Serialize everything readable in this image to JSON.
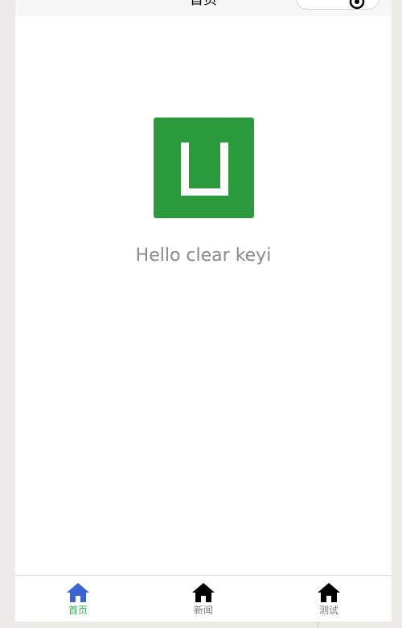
{
  "nav": {
    "title": "首页"
  },
  "main": {
    "greeting": "Hello clear keyi"
  },
  "tabbar": {
    "items": [
      {
        "label": "首页",
        "icon": "home-icon",
        "active": true,
        "color": "#3a63d4"
      },
      {
        "label": "新闻",
        "icon": "home-icon",
        "active": false,
        "color": "#000000"
      },
      {
        "label": "测试",
        "icon": "home-icon",
        "active": false,
        "color": "#000000"
      }
    ]
  },
  "colors": {
    "logo_bg": "#2b9a3c",
    "active_tab": "#2bb24c",
    "greeting_text": "#8a8a8a"
  }
}
